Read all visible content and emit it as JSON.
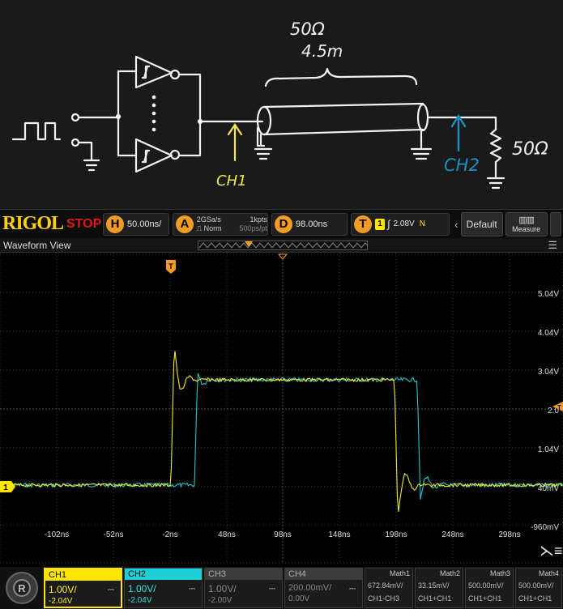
{
  "schematic": {
    "impedance_label": "50Ω",
    "length_label": "4.5m",
    "ch1_label": "CH1",
    "ch2_label": "CH2",
    "termination_label": "50Ω",
    "colors": {
      "ink": "#ffffff",
      "ch1": "#f5e94a",
      "ch2": "#1c8fc0"
    }
  },
  "toolbar": {
    "logo": "RIGOL",
    "run_state": "STOP",
    "horizontal": {
      "badge": "H",
      "value": "50.00ns/"
    },
    "acquire": {
      "badge": "A",
      "rate": "2GSa/s",
      "points": "1kpts",
      "mode": "Norm",
      "resolution": "500ps/pt"
    },
    "delay": {
      "badge": "D",
      "value": "98.00ns"
    },
    "trigger": {
      "badge": "T",
      "source": "1",
      "level": "2.08V",
      "sweep": "N"
    },
    "default_label": "Default",
    "measure_label": "Measure"
  },
  "waveform": {
    "title": "Waveform View",
    "trigger_marker": "T",
    "y_labels": [
      "5.04V",
      "4.04V",
      "3.04V",
      "2.0",
      "1.04V",
      "40mV",
      "-960mV"
    ],
    "x_labels": [
      "-102ns",
      "-52ns",
      "-2ns",
      "48ns",
      "98ns",
      "148ns",
      "198ns",
      "248ns",
      "298ns"
    ],
    "ch1_ground_marker": "1",
    "colors": {
      "ch1": "#f2ea22",
      "ch2": "#22c6d2",
      "grid": "#3a3a3a",
      "trigger": "#f39c24"
    }
  },
  "channels": [
    {
      "name": "CH1",
      "scale": "1.00V/",
      "offset": "-2.04V"
    },
    {
      "name": "CH2",
      "scale": "1.00V/",
      "offset": "-2.04V"
    },
    {
      "name": "CH3",
      "scale": "1.00V/",
      "offset": "-2.00V"
    },
    {
      "name": "CH4",
      "scale": "200.00mV/",
      "offset": "0.00V"
    }
  ],
  "maths": [
    {
      "name": "Math1",
      "value": "672.84mV/",
      "source": "CH1-CH3"
    },
    {
      "name": "Math2",
      "value": "33.15mV/",
      "source": "CH1+CH1"
    },
    {
      "name": "Math3",
      "value": "500.00mV/",
      "source": "CH1+CH1"
    },
    {
      "name": "Math4",
      "value": "500.00mV/",
      "source": "CH1+CH1"
    }
  ]
}
